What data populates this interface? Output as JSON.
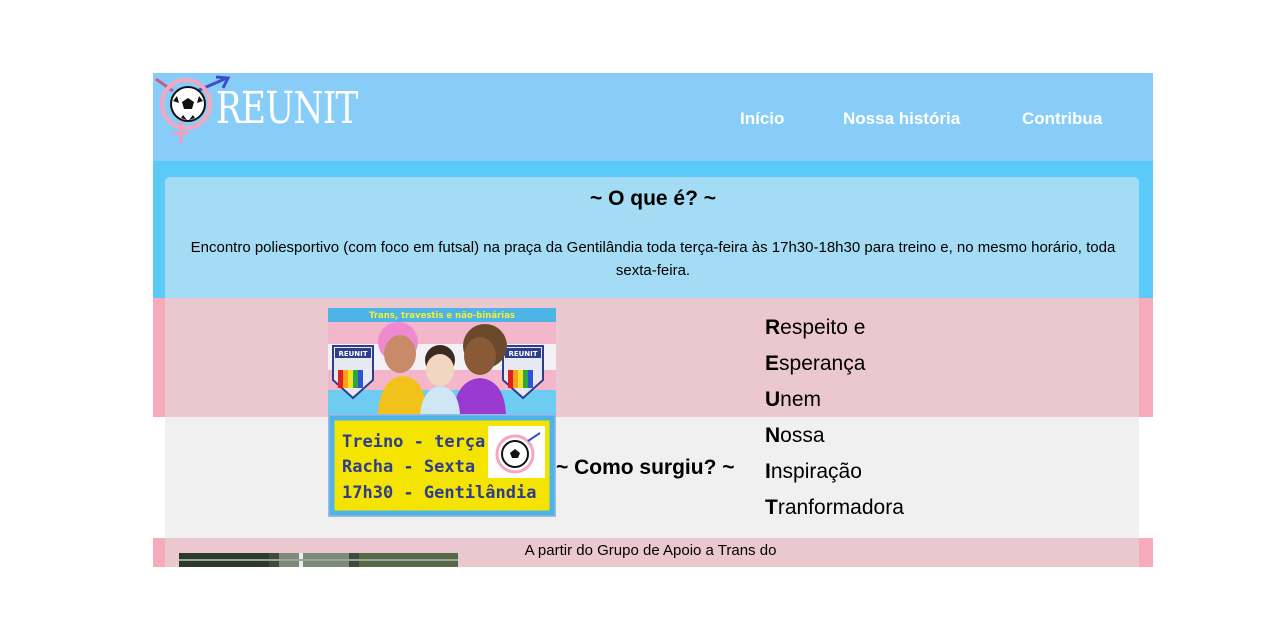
{
  "header": {
    "logo_text": "REUNIT",
    "nav": [
      "Início",
      "Nossa história",
      "Contribua"
    ]
  },
  "about": {
    "title": "~ O que é? ~",
    "description": "Encontro poliesportivo (com foco em futsal) na praça da Gentilândia toda terça-feira às 17h30-18h30 para treino e, no mesmo horário, toda sexta-feira."
  },
  "poster": {
    "top_caption": "Trans, travestis e não-binárias",
    "badge_text": "REUNIT",
    "schedule": [
      "Treino - terça",
      "Racha - Sexta",
      "17h30 - Gentilândia"
    ]
  },
  "history": {
    "title": "~ Como surgiu? ~",
    "intro": "A partir do Grupo de Apoio a Trans do Centro de Referência LGBT"
  },
  "acronym": [
    {
      "letter": "R",
      "rest": "espeito e"
    },
    {
      "letter": "E",
      "rest": "sperança"
    },
    {
      "letter": "U",
      "rest": "nem"
    },
    {
      "letter": "N",
      "rest": "ossa"
    },
    {
      "letter": "I",
      "rest": "nspiração"
    },
    {
      "letter": "T",
      "rest": "ranformadora"
    }
  ],
  "colors": {
    "header_blue": "#88cdf8",
    "band_blue": "#5bcaf8",
    "box_blue": "#a3dcf4",
    "band_pink": "#f5abb9",
    "box_pink": "#ebc8d0",
    "box_gray": "#f0f0f1"
  },
  "icons": [
    "transgender-symbol-icon",
    "soccer-ball-icon"
  ]
}
